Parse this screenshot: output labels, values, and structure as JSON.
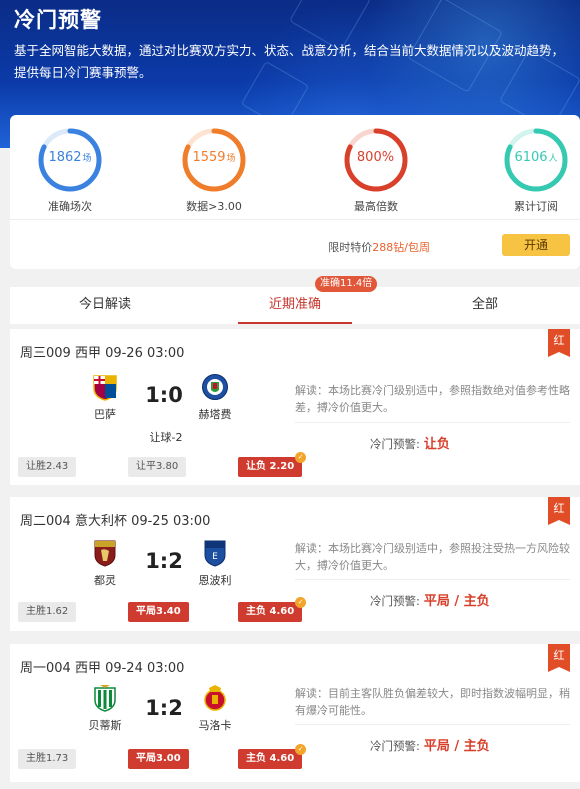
{
  "header": {
    "title": "冷门预警",
    "description": "基于全网智能大数据，通过对比赛双方实力、状态、战意分析，结合当前大数据情况以及波动趋势，提供每日冷门赛事预警。"
  },
  "stats": [
    {
      "value": "1862",
      "unit": "场",
      "label": "准确场次",
      "color": "#3b82e0"
    },
    {
      "value": "1559",
      "unit": "场",
      "label": "数据>3.00",
      "color": "#ef7d2a"
    },
    {
      "value": "800%",
      "unit": "",
      "label": "最高倍数",
      "color": "#d8402c"
    },
    {
      "value": "6106",
      "unit": "人",
      "label": "累计订阅",
      "color": "#35c9b1"
    }
  ],
  "promo": {
    "prefix": "限时特价",
    "price": "288钻/包周",
    "button": "开通"
  },
  "tabs": [
    {
      "label": "今日解读",
      "active": false
    },
    {
      "label": "近期准确",
      "active": true
    },
    {
      "label": "全部",
      "active": false
    }
  ],
  "tab_badge": "准确11.4倍",
  "matches": [
    {
      "header": "周三009 西甲 09-26 03:00",
      "flag": "红",
      "home": "巴萨",
      "away": "赫塔费",
      "score": "1:0",
      "handicap": "让球-2",
      "odds": [
        "让胜2.43",
        "让平3.80",
        "让负 2.20"
      ],
      "analysis": "解读：本场比赛冷门级别适中，参照指数绝对值参考性略差，搏冷价值更大。",
      "warning_label": "冷门预警:",
      "warning_pick": "让负"
    },
    {
      "header": "周二004 意大利杯 09-25 03:00",
      "flag": "红",
      "home": "都灵",
      "away": "恩波利",
      "score": "1:2",
      "handicap": "",
      "odds": [
        "主胜1.62",
        "平局3.40",
        "主负 4.60"
      ],
      "analysis": "解读：本场比赛冷门级别适中，参照投注受热一方风险较大，搏冷价值更大。",
      "warning_label": "冷门预警:",
      "warning_pick": "平局 / 主负"
    },
    {
      "header": "周一004 西甲 09-24 03:00",
      "flag": "红",
      "home": "贝蒂斯",
      "away": "马洛卡",
      "score": "1:2",
      "handicap": "",
      "odds": [
        "主胜1.73",
        "平局3.00",
        "主负 4.60"
      ],
      "analysis": "解读：目前主客队胜负偏差较大，即时指数波幅明显，稍有爆冷可能性。",
      "warning_label": "冷门预警:",
      "warning_pick": "平局 / 主负"
    }
  ]
}
